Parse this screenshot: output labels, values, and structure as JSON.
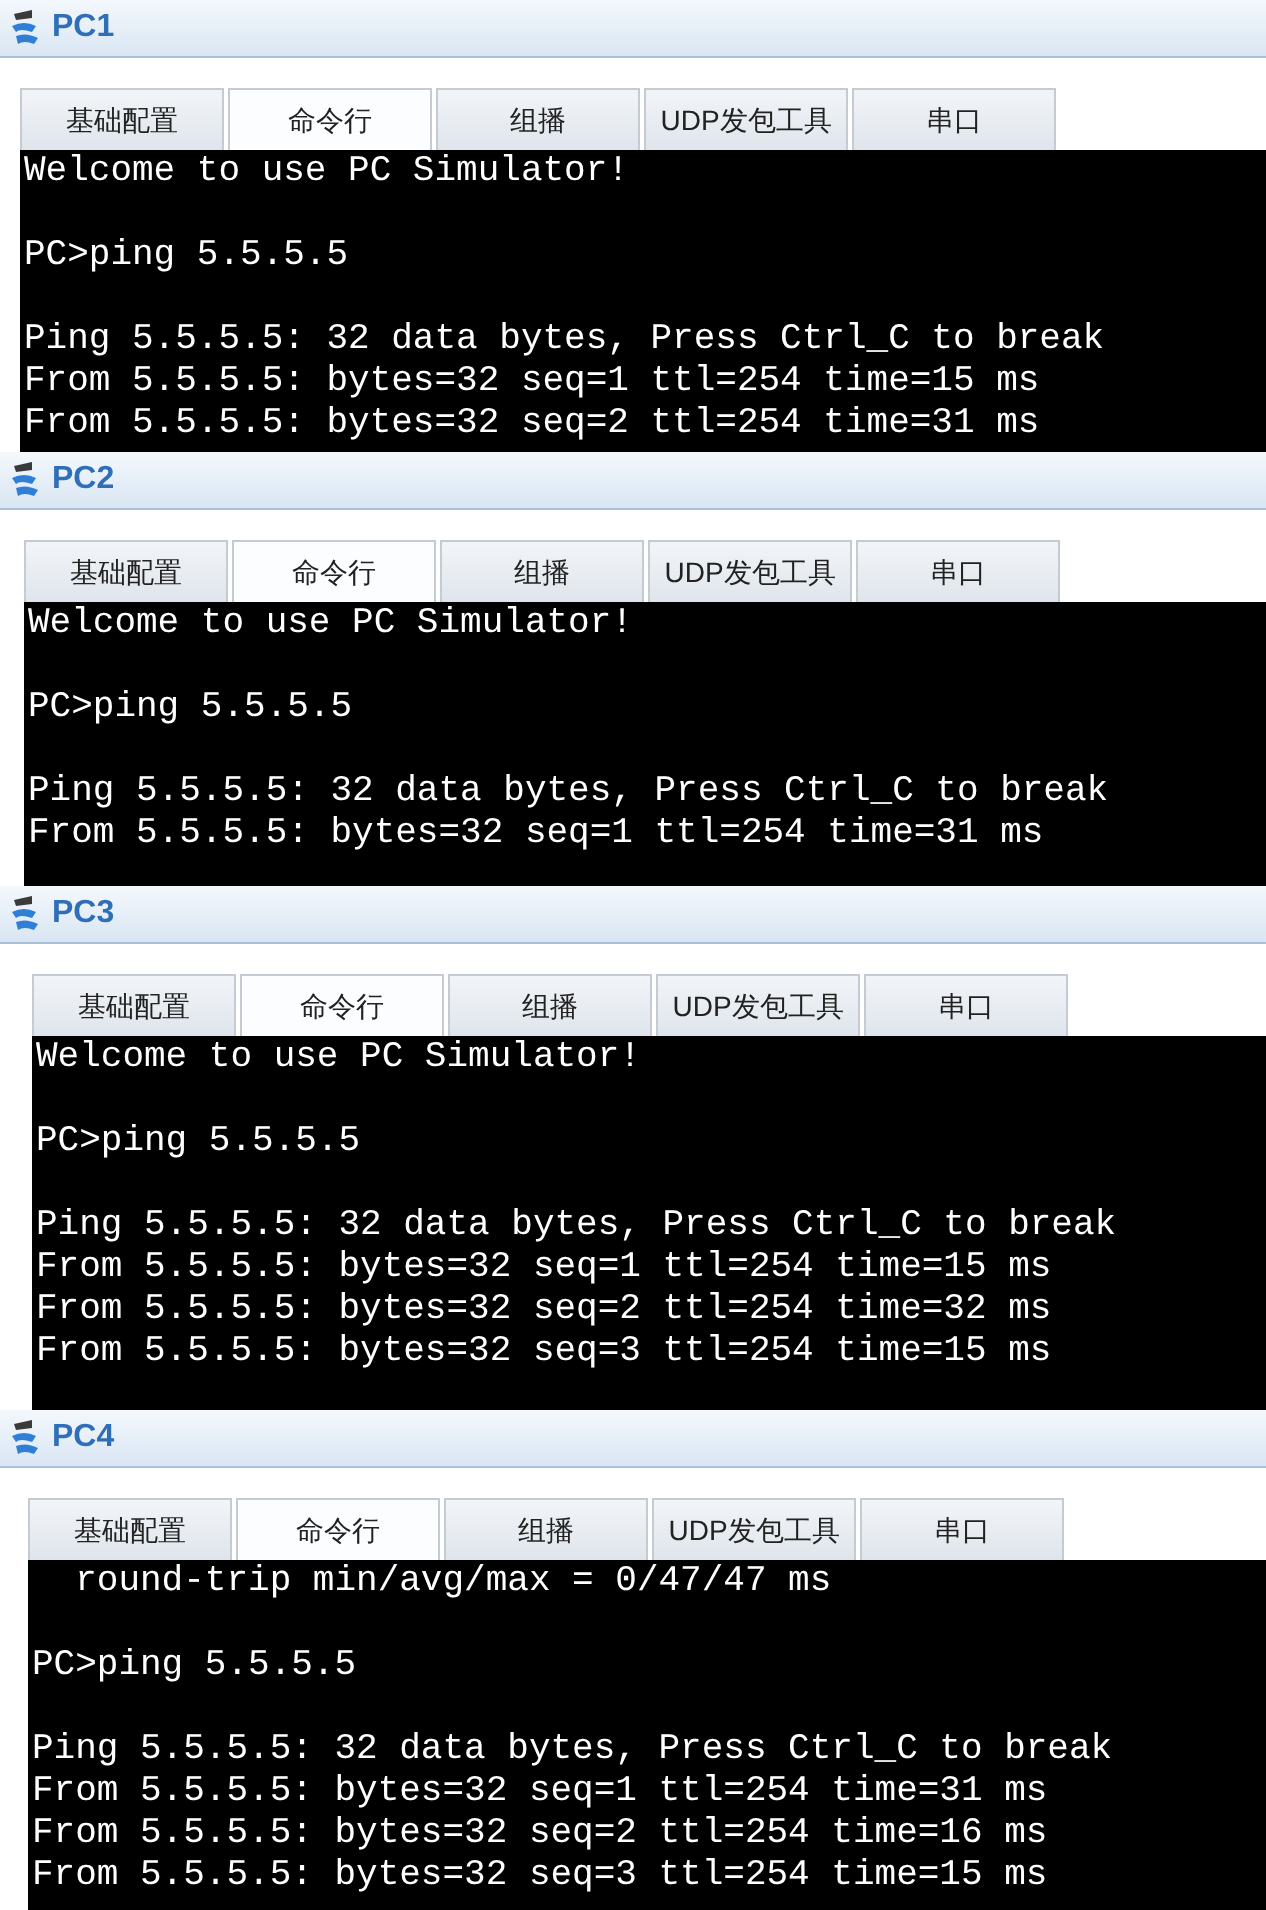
{
  "windows": [
    {
      "title": "PC1",
      "tabs": [
        {
          "label": "基础配置",
          "selected": false
        },
        {
          "label": "命令行",
          "selected": true
        },
        {
          "label": "组播",
          "selected": false
        },
        {
          "label": "UDP发包工具",
          "selected": false
        },
        {
          "label": "串口",
          "selected": false
        }
      ],
      "terminal": [
        [
          "Welcome to use PC Simulator!"
        ],
        [
          "PC>ping 5.5.5.5"
        ],
        [
          "Ping 5.5.5.5: 32 data bytes, Press Ctrl_C to break",
          "From 5.5.5.5: bytes=32 seq=1 ttl=254 time=15 ms",
          "From 5.5.5.5: bytes=32 seq=2 ttl=254 time=31 ms"
        ]
      ]
    },
    {
      "title": "PC2",
      "tabs": [
        {
          "label": "基础配置",
          "selected": false
        },
        {
          "label": "命令行",
          "selected": true
        },
        {
          "label": "组播",
          "selected": false
        },
        {
          "label": "UDP发包工具",
          "selected": false
        },
        {
          "label": "串口",
          "selected": false
        }
      ],
      "terminal": [
        [
          "Welcome to use PC Simulator!"
        ],
        [
          "PC>ping 5.5.5.5"
        ],
        [
          "Ping 5.5.5.5: 32 data bytes, Press Ctrl_C to break",
          "From 5.5.5.5: bytes=32 seq=1 ttl=254 time=31 ms"
        ]
      ]
    },
    {
      "title": "PC3",
      "tabs": [
        {
          "label": "基础配置",
          "selected": false
        },
        {
          "label": "命令行",
          "selected": true
        },
        {
          "label": "组播",
          "selected": false
        },
        {
          "label": "UDP发包工具",
          "selected": false
        },
        {
          "label": "串口",
          "selected": false
        }
      ],
      "terminal": [
        [
          "Welcome to use PC Simulator!"
        ],
        [
          "PC>ping 5.5.5.5"
        ],
        [
          "Ping 5.5.5.5: 32 data bytes, Press Ctrl_C to break",
          "From 5.5.5.5: bytes=32 seq=1 ttl=254 time=15 ms",
          "From 5.5.5.5: bytes=32 seq=2 ttl=254 time=32 ms",
          "From 5.5.5.5: bytes=32 seq=3 ttl=254 time=15 ms"
        ]
      ]
    },
    {
      "title": "PC4",
      "tabs": [
        {
          "label": "基础配置",
          "selected": false
        },
        {
          "label": "命令行",
          "selected": true
        },
        {
          "label": "组播",
          "selected": false
        },
        {
          "label": "UDP发包工具",
          "selected": false
        },
        {
          "label": "串口",
          "selected": false
        }
      ],
      "terminal": [
        [
          "  round-trip min/avg/max = 0/47/47 ms"
        ],
        [
          "PC>ping 5.5.5.5"
        ],
        [
          "Ping 5.5.5.5: 32 data bytes, Press Ctrl_C to break",
          "From 5.5.5.5: bytes=32 seq=1 ttl=254 time=31 ms",
          "From 5.5.5.5: bytes=32 seq=2 ttl=254 time=16 ms",
          "From 5.5.5.5: bytes=32 seq=3 ttl=254 time=15 ms"
        ]
      ]
    }
  ]
}
